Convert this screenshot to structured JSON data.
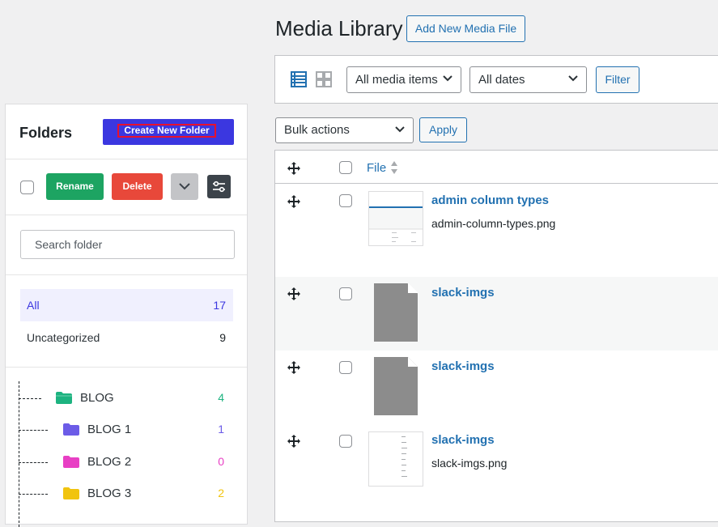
{
  "header": {
    "title": "Media Library",
    "add_new_label": "Add New Media File"
  },
  "toolbar": {
    "media_filter": "All media items",
    "date_filter": "All dates",
    "filter_label": "Filter",
    "view_modes": [
      "list-view-icon",
      "grid-view-icon"
    ],
    "active_view": "list"
  },
  "bulk": {
    "actions_label": "Bulk actions",
    "apply_label": "Apply"
  },
  "table": {
    "column_file": "File",
    "rows": [
      {
        "title": "admin column types",
        "filename": "admin-column-types.png",
        "thumb": "screenshot"
      },
      {
        "title": "slack-imgs",
        "filename": "",
        "thumb": "generic-document"
      },
      {
        "title": "slack-imgs",
        "filename": "",
        "thumb": "generic-document"
      },
      {
        "title": "slack-imgs",
        "filename": "slack-imgs.png",
        "thumb": "text-list"
      }
    ]
  },
  "folders": {
    "title": "Folders",
    "create_label": "Create New Folder",
    "rename_label": "Rename",
    "delete_label": "Delete",
    "search_placeholder": "Search folder",
    "all": {
      "label": "All",
      "count": "17"
    },
    "uncategorized": {
      "label": "Uncategorized",
      "count": "9"
    },
    "tree": [
      {
        "label": "BLOG",
        "count": "4",
        "color": "#1db380"
      },
      {
        "label": "BLOG 1",
        "count": "1",
        "color": "#6c5ce7"
      },
      {
        "label": "BLOG 2",
        "count": "0",
        "color": "#e83fc4"
      },
      {
        "label": "BLOG 3",
        "count": "2",
        "color": "#f1c40f"
      }
    ]
  },
  "colors": {
    "accent": "#2271b1",
    "create_button": "#3b37e0",
    "rename_button": "#1da462",
    "delete_button": "#e8483a",
    "active_row": "#f0f0fe",
    "count_all": "#3b37e0"
  }
}
